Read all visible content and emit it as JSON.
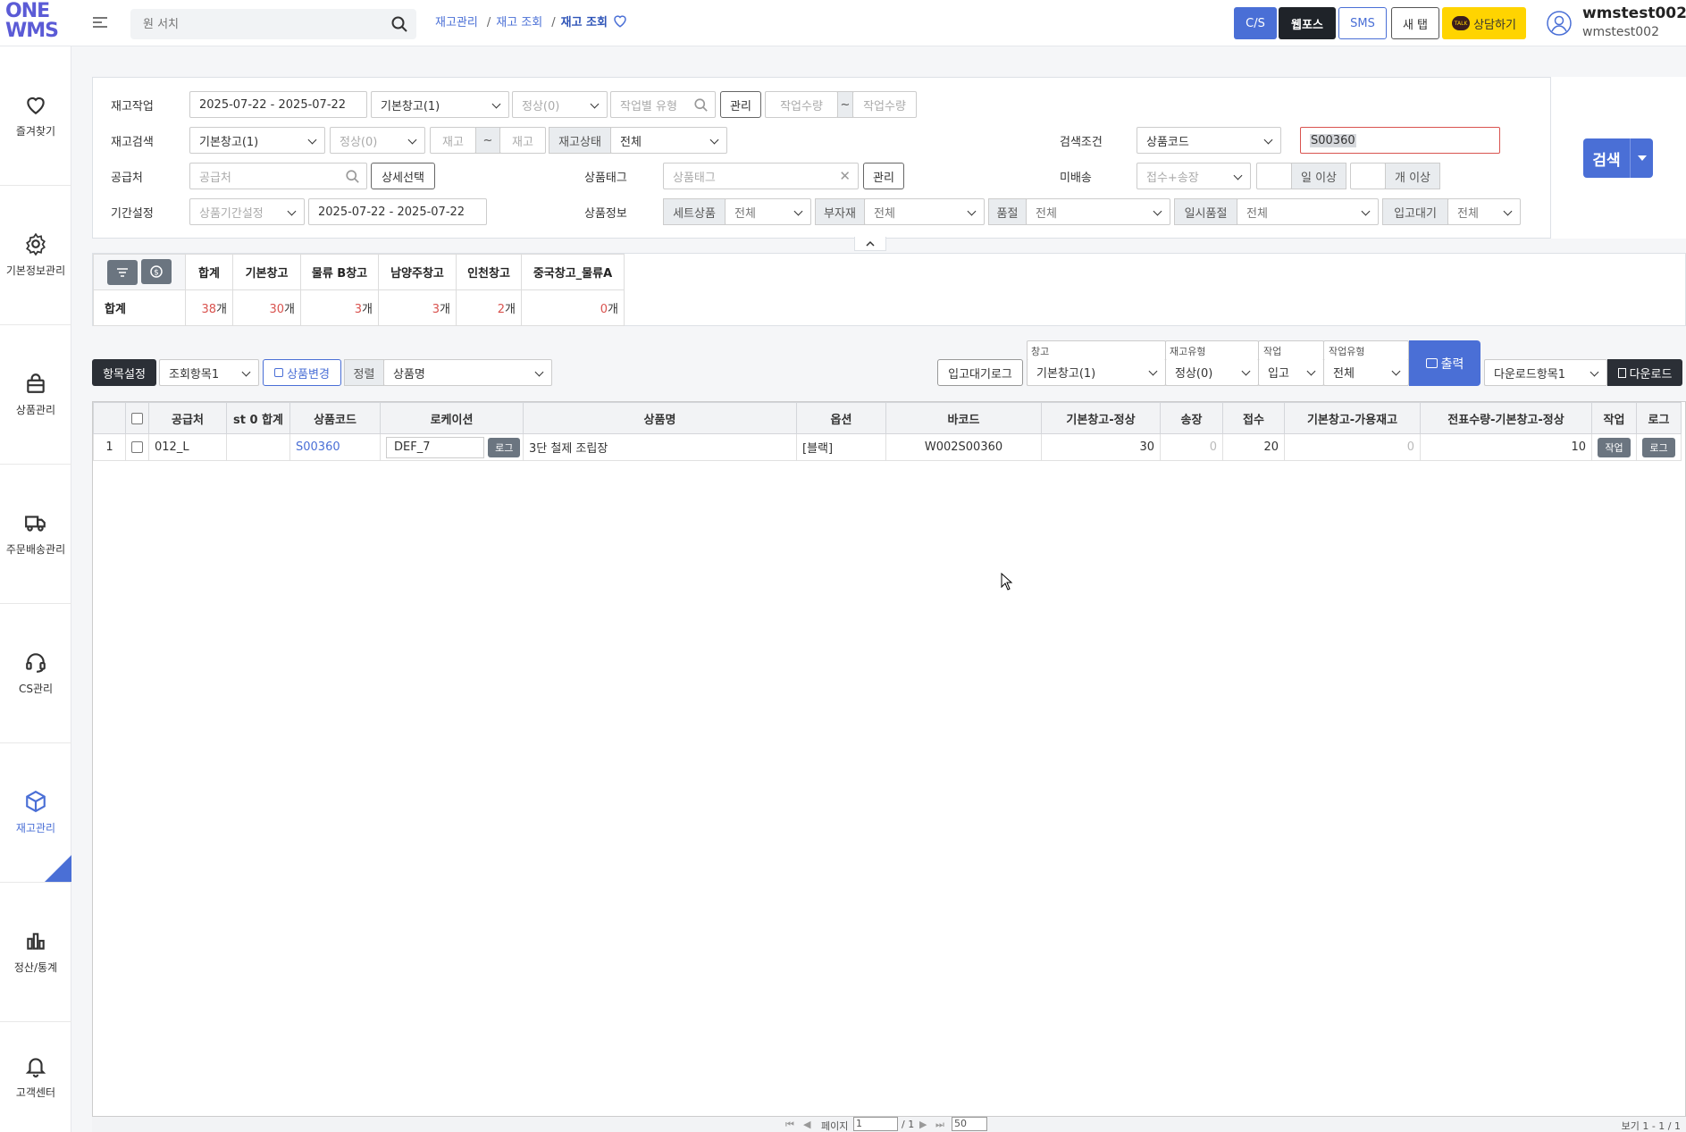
{
  "header": {
    "logo_top": "ONE",
    "logo_bottom": "WMS",
    "search_placeholder": "원 서치",
    "breadcrumb": [
      "재고관리",
      "재고 조회",
      "재고 조회"
    ],
    "buttons": {
      "cs": "C/S",
      "webpos": "웹포스",
      "sms": "SMS",
      "newtab": "새 탭",
      "consult": "상담하기"
    },
    "kakao_talk": "TALK",
    "user_name": "wmstest002",
    "user_id": "wmstest002"
  },
  "sidebar": {
    "items": [
      {
        "label": "즐겨찾기",
        "icon": "heart-icon"
      },
      {
        "label": "기본정보관리",
        "icon": "gear-icon"
      },
      {
        "label": "상품관리",
        "icon": "bag-icon"
      },
      {
        "label": "주문배송관리",
        "icon": "truck-icon"
      },
      {
        "label": "CS관리",
        "icon": "headset-icon"
      },
      {
        "label": "재고관리",
        "icon": "cube-icon"
      },
      {
        "label": "정산/통계",
        "icon": "bar-chart-icon"
      },
      {
        "label": "고객센터",
        "icon": "bell-icon"
      }
    ]
  },
  "filters": {
    "stock_work_label": "재고작업",
    "stock_work_date": "2025-07-22 - 2025-07-22",
    "stock_work_warehouse": "기본창고(1)",
    "stock_work_status": "정상(0)",
    "work_type_placeholder": "작업별 유형",
    "manage_label": "관리",
    "work_qty_from": "작업수량",
    "tilde": "~",
    "work_qty_to": "작업수량",
    "stock_search_label": "재고검색",
    "stock_search_warehouse": "기본창고(1)",
    "stock_search_status": "정상(0)",
    "stock_from": "재고",
    "stock_to": "재고",
    "stock_state_tag": "재고상태",
    "stock_state_value": "전체",
    "search_cond_label": "검색조건",
    "search_cond_select": "상품코드",
    "search_cond_value": "S00360",
    "supplier_label": "공급처",
    "supplier_placeholder": "공급처",
    "detail_select": "상세선택",
    "product_tag_label": "상품태그",
    "product_tag_placeholder": "상품태그",
    "product_tag_manage": "관리",
    "undelivered_label": "미배송",
    "undelivered_select": "접수+송장",
    "days_over": "일 이상",
    "count_over": "개 이상",
    "period_label": "기간설정",
    "period_select": "상품기간설정",
    "period_date": "2025-07-22 - 2025-07-22",
    "product_info_label": "상품정보",
    "set_product_tag": "세트상품",
    "set_product_value": "전체",
    "sub_material_tag": "부자재",
    "sub_material_value": "전체",
    "soldout_tag": "품절",
    "soldout_value": "전체",
    "temp_soldout_tag": "일시품절",
    "temp_soldout_value": "전체",
    "inbound_wait_tag": "입고대기",
    "inbound_wait_value": "전체",
    "search_button": "검색"
  },
  "summary": {
    "headers": [
      "합계",
      "기본창고",
      "물류 B창고",
      "남양주창고",
      "인천창고",
      "중국창고_물류A"
    ],
    "row_label": "합계",
    "values": [
      "38",
      "30",
      "3",
      "3",
      "2",
      "0"
    ],
    "unit": "개"
  },
  "toolbar": {
    "item_settings": "항목설정",
    "view_item": "조회항목1",
    "product_change": "상품변경",
    "sort_tag": "정렬",
    "sort_value": "상품명",
    "inbound_log": "입고대기로그",
    "warehouse_lbl": "창고",
    "warehouse_val": "기본창고(1)",
    "stock_type_lbl": "재고유형",
    "stock_type_val": "정상(0)",
    "work_lbl": "작업",
    "work_val": "입고",
    "work_type_lbl": "작업유형",
    "work_type_val": "전체",
    "print": "출력",
    "download_item": "다운로드항목1",
    "download": "다운로드"
  },
  "grid": {
    "headers": [
      "",
      "",
      "공급처",
      "st 0 합계",
      "상품코드",
      "로케이션",
      "상품명",
      "옵션",
      "바코드",
      "기본창고-정상",
      "송장",
      "접수",
      "기본창고-가용재고",
      "전표수량-기본창고-정상",
      "작업",
      "로그"
    ],
    "rows": [
      {
        "no": "1",
        "supplier": "012_L",
        "st0_total": "",
        "code": "S00360",
        "location": "DEF_7",
        "location_log": "로그",
        "name": "3단 철제 조립장",
        "option": "[블랙]",
        "barcode": "W002S00360",
        "normal": "30",
        "invoice": "0",
        "received": "20",
        "available": "0",
        "slip_qty": "10",
        "work_btn": "작업",
        "log_btn": "로그"
      }
    ]
  },
  "pager": {
    "page_label": "페이지",
    "page_value": "1",
    "total_pages": "/ 1",
    "page_size": "50",
    "view_info": "보기 1 - 1 / 1"
  }
}
